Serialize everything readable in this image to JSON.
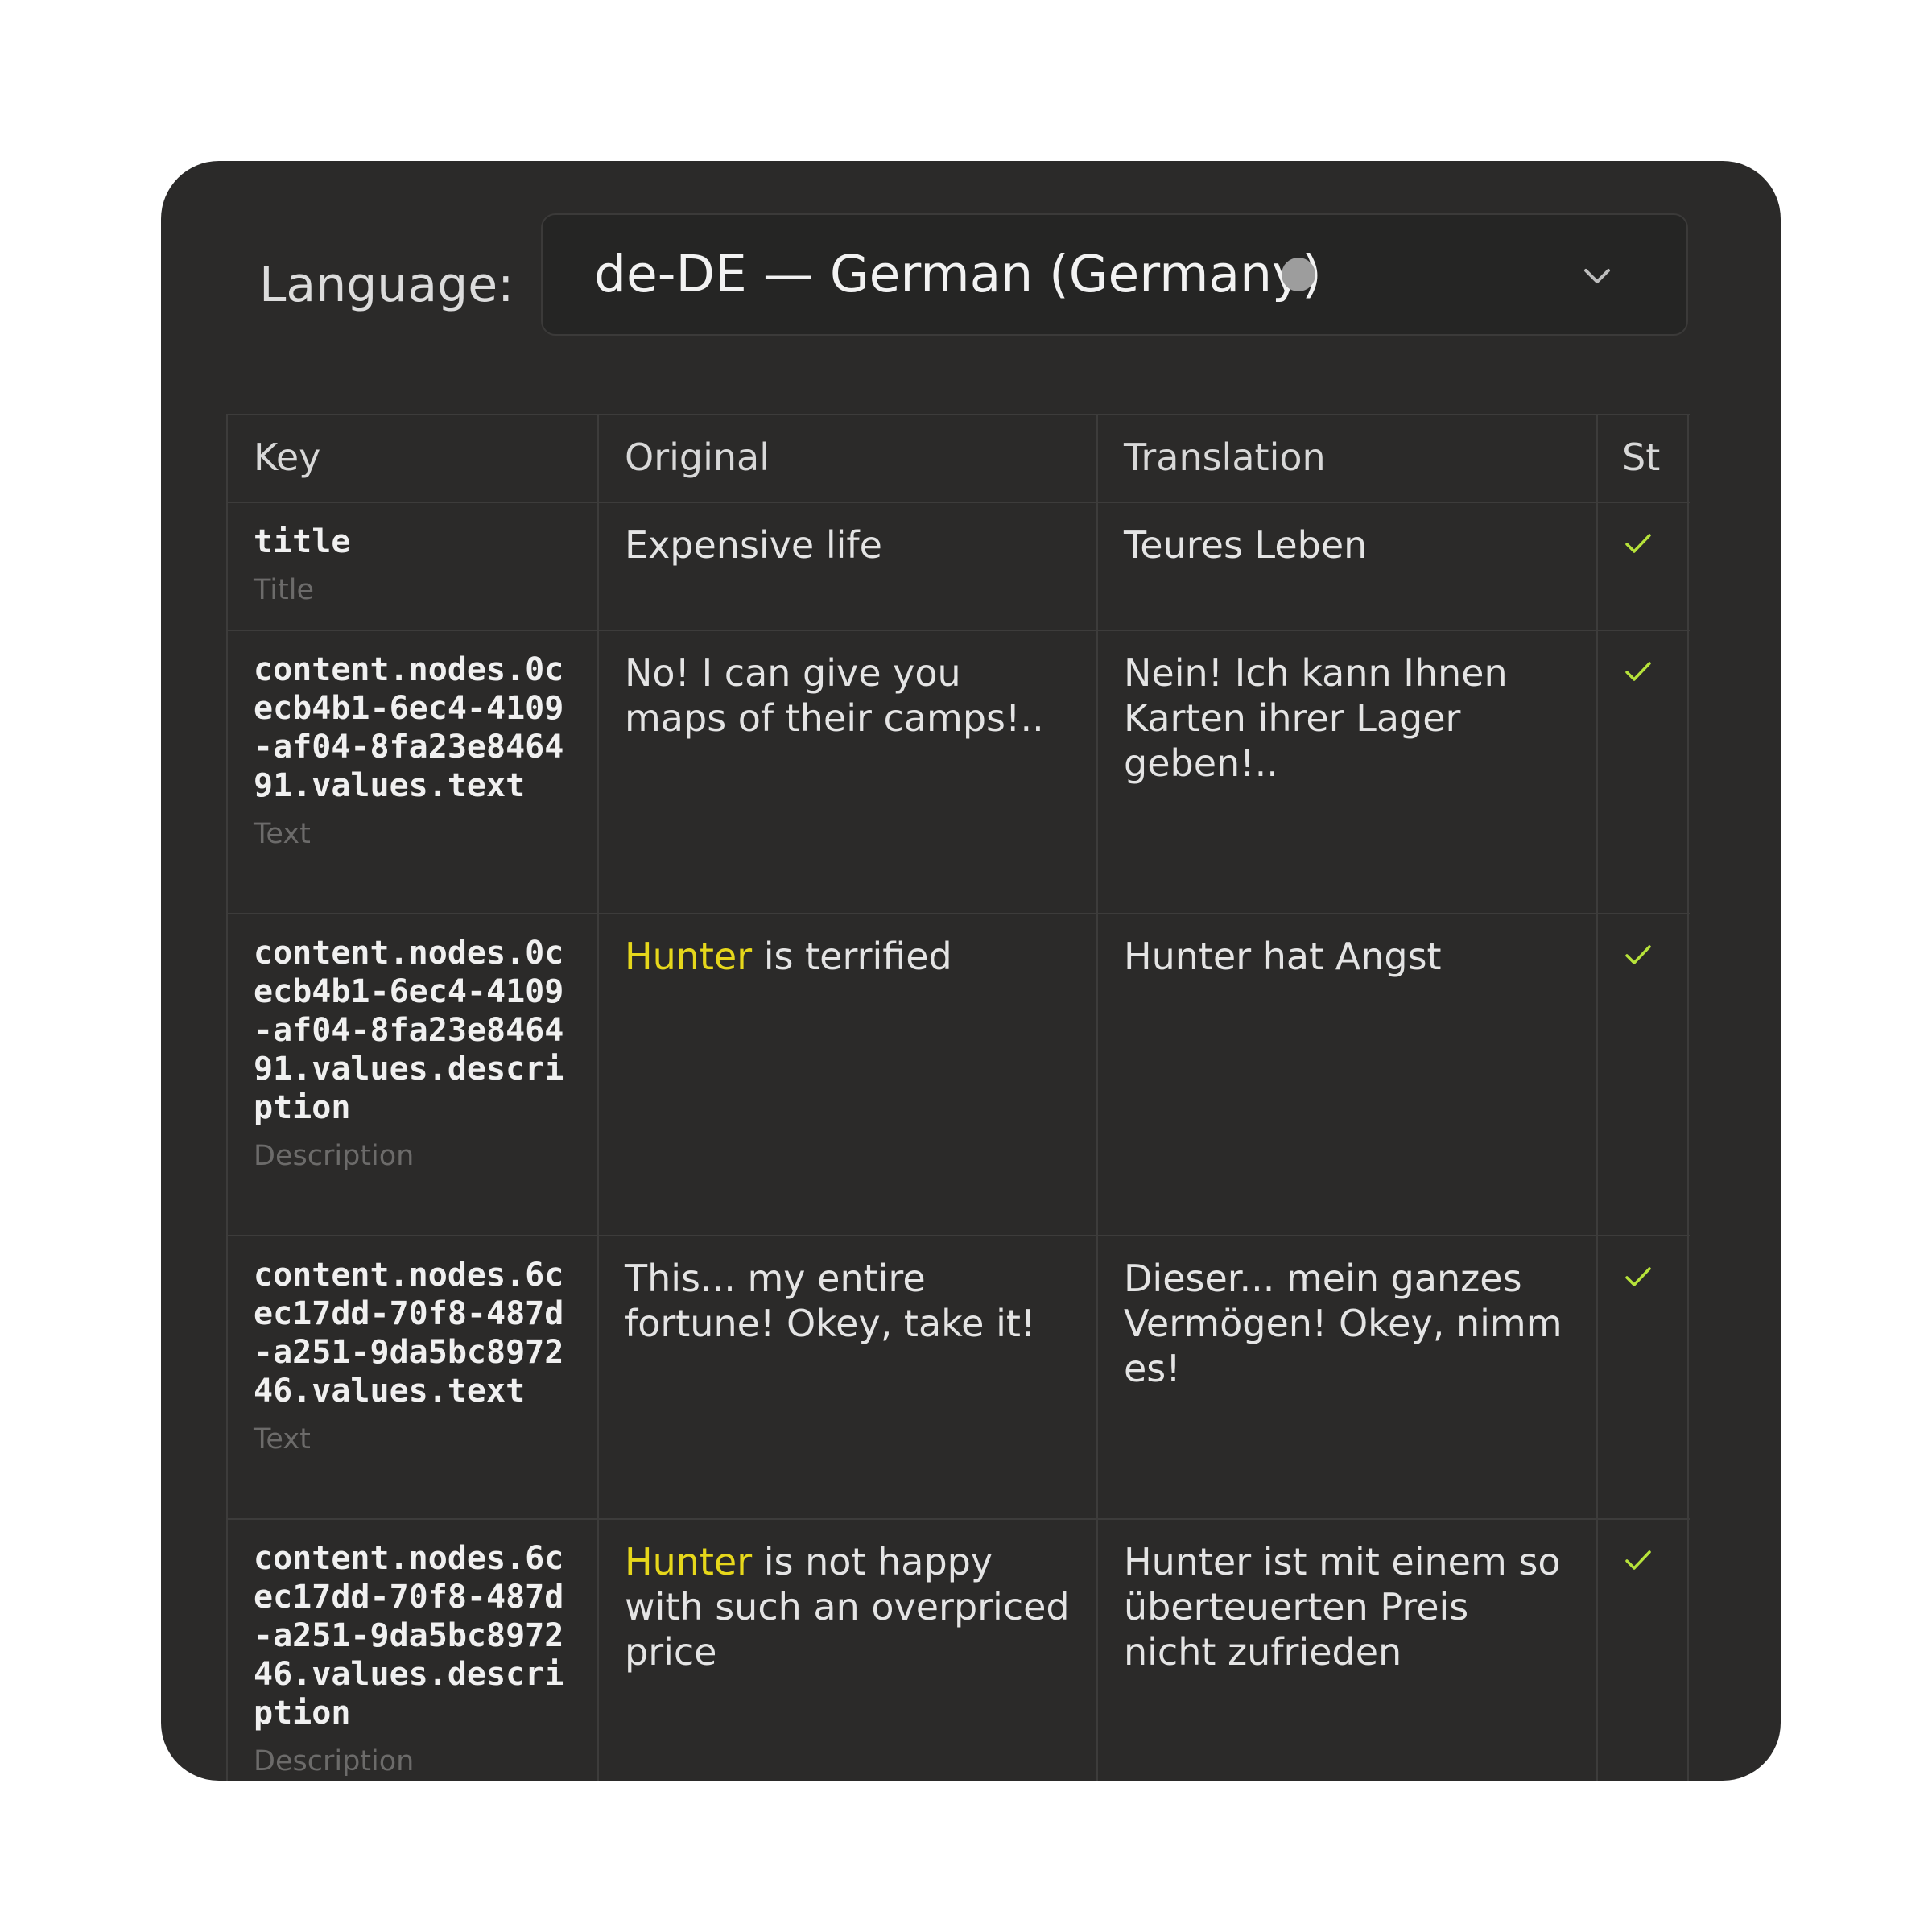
{
  "language": {
    "label": "Language:",
    "selected": "de-DE — German (Germany)"
  },
  "table": {
    "headers": {
      "key": "Key",
      "original": "Original",
      "translation": "Translation",
      "status": "St"
    },
    "rows": [
      {
        "key": "title",
        "type": "Title",
        "original": "Expensive life",
        "translation": "Teures Leben",
        "status": "checkmark-icon"
      },
      {
        "key": "content.nodes.0cecb4b1-6ec4-4109-af04-8fa23e846491.values.text",
        "type": "Text",
        "original": "No! I can give you maps of their camps!..",
        "translation": "Nein! Ich kann Ihnen Karten ihrer Lager geben!..",
        "status": "checkmark-icon"
      },
      {
        "key": "content.nodes.0cecb4b1-6ec4-4109-af04-8fa23e846491.values.description",
        "type": "Description",
        "original_highlight": "Hunter",
        "original_rest": " is terrified",
        "translation": "Hunter hat Angst",
        "status": "checkmark-icon"
      },
      {
        "key": "content.nodes.6cec17dd-70f8-487d-a251-9da5bc897246.values.text",
        "type": "Text",
        "original": "This... my entire fortune! Okey, take it!",
        "translation": "Dieser... mein ganzes Vermögen! Okey, nimm es!",
        "status": "checkmark-icon"
      },
      {
        "key": "content.nodes.6cec17dd-70f8-487d-a251-9da5bc897246.values.description",
        "type": "Description",
        "original_highlight": "Hunter",
        "original_rest": " is not happy with such an overpriced price",
        "translation": "Hunter ist mit einem so überteuerten Preis nicht zufrieden",
        "status": "checkmark-icon"
      }
    ]
  },
  "colors": {
    "panel": "#2b2a29",
    "highlight": "#e6d71b",
    "check": "#b7e33a",
    "status_dot": "#9d9d9d"
  }
}
